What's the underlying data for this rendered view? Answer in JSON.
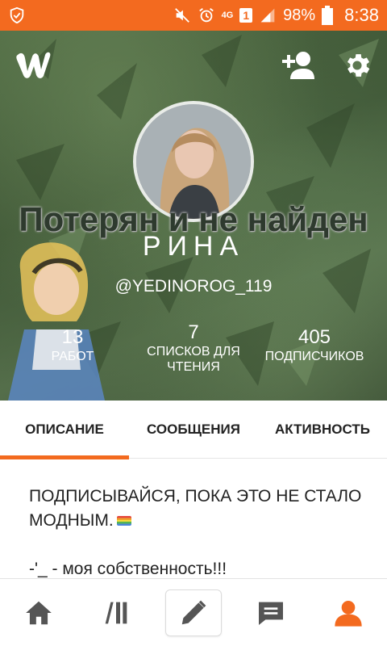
{
  "status_bar": {
    "battery_percent": "98%",
    "time": "8:38",
    "network": "4G",
    "sim_badge": "1"
  },
  "profile": {
    "tagline": "Потерян и не найден",
    "name": "РИНА",
    "username": "@YEDINOROG_119",
    "stats": [
      {
        "value": "13",
        "label": "РАБОТ"
      },
      {
        "value": "7",
        "label": "СПИСКОВ ДЛЯ ЧТЕНИЯ"
      },
      {
        "value": "405",
        "label": "ПОДПИСЧИКОВ"
      }
    ]
  },
  "tabs": [
    {
      "label": "ОПИСАНИЕ",
      "active": true
    },
    {
      "label": "СООБЩЕНИЯ",
      "active": false
    },
    {
      "label": "АКТИВНОСТЬ",
      "active": false
    }
  ],
  "description": {
    "lines": [
      "ПОДПИСЫВАЙСЯ, ПОКА ЭТО НЕ СТАЛО",
      "МОДНЫМ.",
      "-'_ - моя собственность!!!"
    ]
  },
  "icons": {
    "logo": "wattpad-logo-icon",
    "add_user": "add-user-icon",
    "settings": "gear-icon",
    "nav": [
      "home-icon",
      "library-icon",
      "write-icon",
      "messages-icon",
      "profile-icon"
    ]
  },
  "colors": {
    "accent": "#f36a1f",
    "text": "#222222",
    "nav_icon": "#555555"
  }
}
